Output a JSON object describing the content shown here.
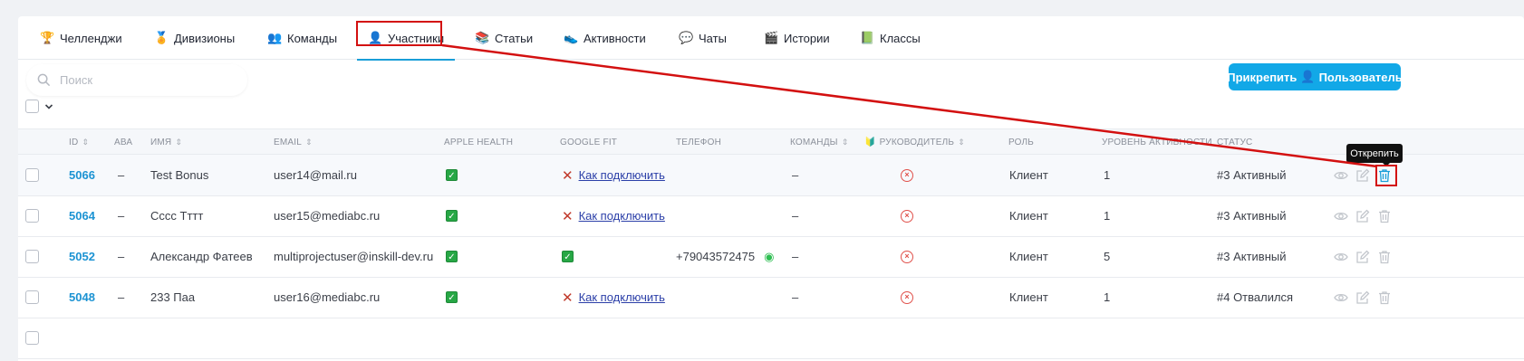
{
  "tabs": [
    {
      "label": "Челленджи",
      "icon": "trophy-icon",
      "glyph": "🏆"
    },
    {
      "label": "Дивизионы",
      "icon": "division-icon",
      "glyph": "🏅"
    },
    {
      "label": "Команды",
      "icon": "team-icon",
      "glyph": "👥"
    },
    {
      "label": "Участники",
      "icon": "participant-icon",
      "glyph": "👤"
    },
    {
      "label": "Статьи",
      "icon": "article-icon",
      "glyph": "📚"
    },
    {
      "label": "Активности",
      "icon": "activity-icon",
      "glyph": "👟"
    },
    {
      "label": "Чаты",
      "icon": "chat-icon",
      "glyph": "💬"
    },
    {
      "label": "Истории",
      "icon": "story-icon",
      "glyph": "🎬"
    },
    {
      "label": "Классы",
      "icon": "class-icon",
      "glyph": "📗"
    }
  ],
  "active_tab": "Участники",
  "search": {
    "placeholder": "Поиск",
    "value": ""
  },
  "attach_button": {
    "label_1": "Прикрепить",
    "icon_glyph": "👤",
    "label_2": "Пользователь"
  },
  "columns": {
    "id": "ID",
    "ava": "АВА",
    "name": "ИМЯ",
    "email": "EMAIL",
    "apple": "APPLE HEALTH",
    "google": "GOOGLE FIT",
    "phone": "ТЕЛЕФОН",
    "teams": "КОМАНДЫ",
    "leader_icon": "🔰",
    "leader": "РУКОВОДИТЕЛЬ",
    "role": "РОЛЬ",
    "level": "УРОВЕНЬ АКТИВНОСТИ",
    "status": "СТАТУС"
  },
  "rows": [
    {
      "id": "5066",
      "ava": "–",
      "name": "Test Bonus",
      "email": "user14@mail.ru",
      "apple": true,
      "google": false,
      "google_link": "Как подключить",
      "phone": "",
      "teams": "–",
      "role": "Клиент",
      "level": "1",
      "status": "#3 Активный"
    },
    {
      "id": "5064",
      "ava": "–",
      "name": "Сссс Тттт",
      "email": "user15@mediabc.ru",
      "apple": true,
      "google": false,
      "google_link": "Как подключить",
      "phone": "",
      "teams": "–",
      "role": "Клиент",
      "level": "1",
      "status": "#3 Активный"
    },
    {
      "id": "5052",
      "ava": "–",
      "name": "Александр Фатеев",
      "email": "multiprojectuser@inskill-dev.ru",
      "apple": true,
      "google": true,
      "google_link": "",
      "phone": "+79043572475",
      "teams": "–",
      "role": "Клиент",
      "level": "5",
      "status": "#3 Активный"
    },
    {
      "id": "5048",
      "ava": "–",
      "name": "233 Паа",
      "email": "user16@mediabc.ru",
      "apple": true,
      "google": false,
      "google_link": "Как подключить",
      "phone": "",
      "teams": "–",
      "role": "Клиент",
      "level": "1",
      "status": "#4 Отвалился"
    }
  ],
  "tooltip": "Открепить",
  "colors": {
    "accent": "#12a8e7",
    "id_link": "#1c93d3",
    "annotation": "#d31010"
  }
}
